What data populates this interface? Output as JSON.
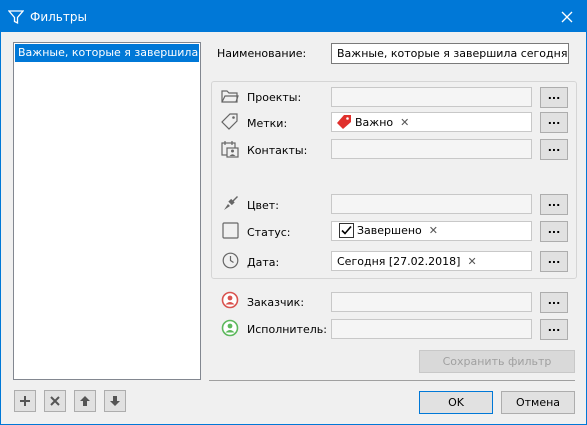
{
  "window": {
    "title": "Фильтры",
    "close_glyph": "✕"
  },
  "list": {
    "items": [
      "Важные, которые я завершила сегодня"
    ]
  },
  "toolbar": {
    "add": "+",
    "delete": "✕"
  },
  "form": {
    "name_label": "Наименование:",
    "name_value": "Важные, которые я завершила сегодня",
    "projects_label": "Проекты:",
    "tags_label": "Метки:",
    "tags_chip": "Важно",
    "contacts_label": "Контакты:",
    "color_label": "Цвет:",
    "status_label": "Статус:",
    "status_chip": "Завершено",
    "date_label": "Дата:",
    "date_chip": "Сегодня [27.02.2018]",
    "customer_label": "Заказчик:",
    "executor_label": "Исполнитель:",
    "browse": "...",
    "chip_remove": "✕"
  },
  "buttons": {
    "save_filter": "Сохранить фильтр",
    "ok": "OK",
    "cancel": "Отмена"
  },
  "colors": {
    "accent": "#0078d7",
    "tag": "#e0302c",
    "customer_icon": "#d9534f",
    "executor_icon": "#5cb85c"
  }
}
